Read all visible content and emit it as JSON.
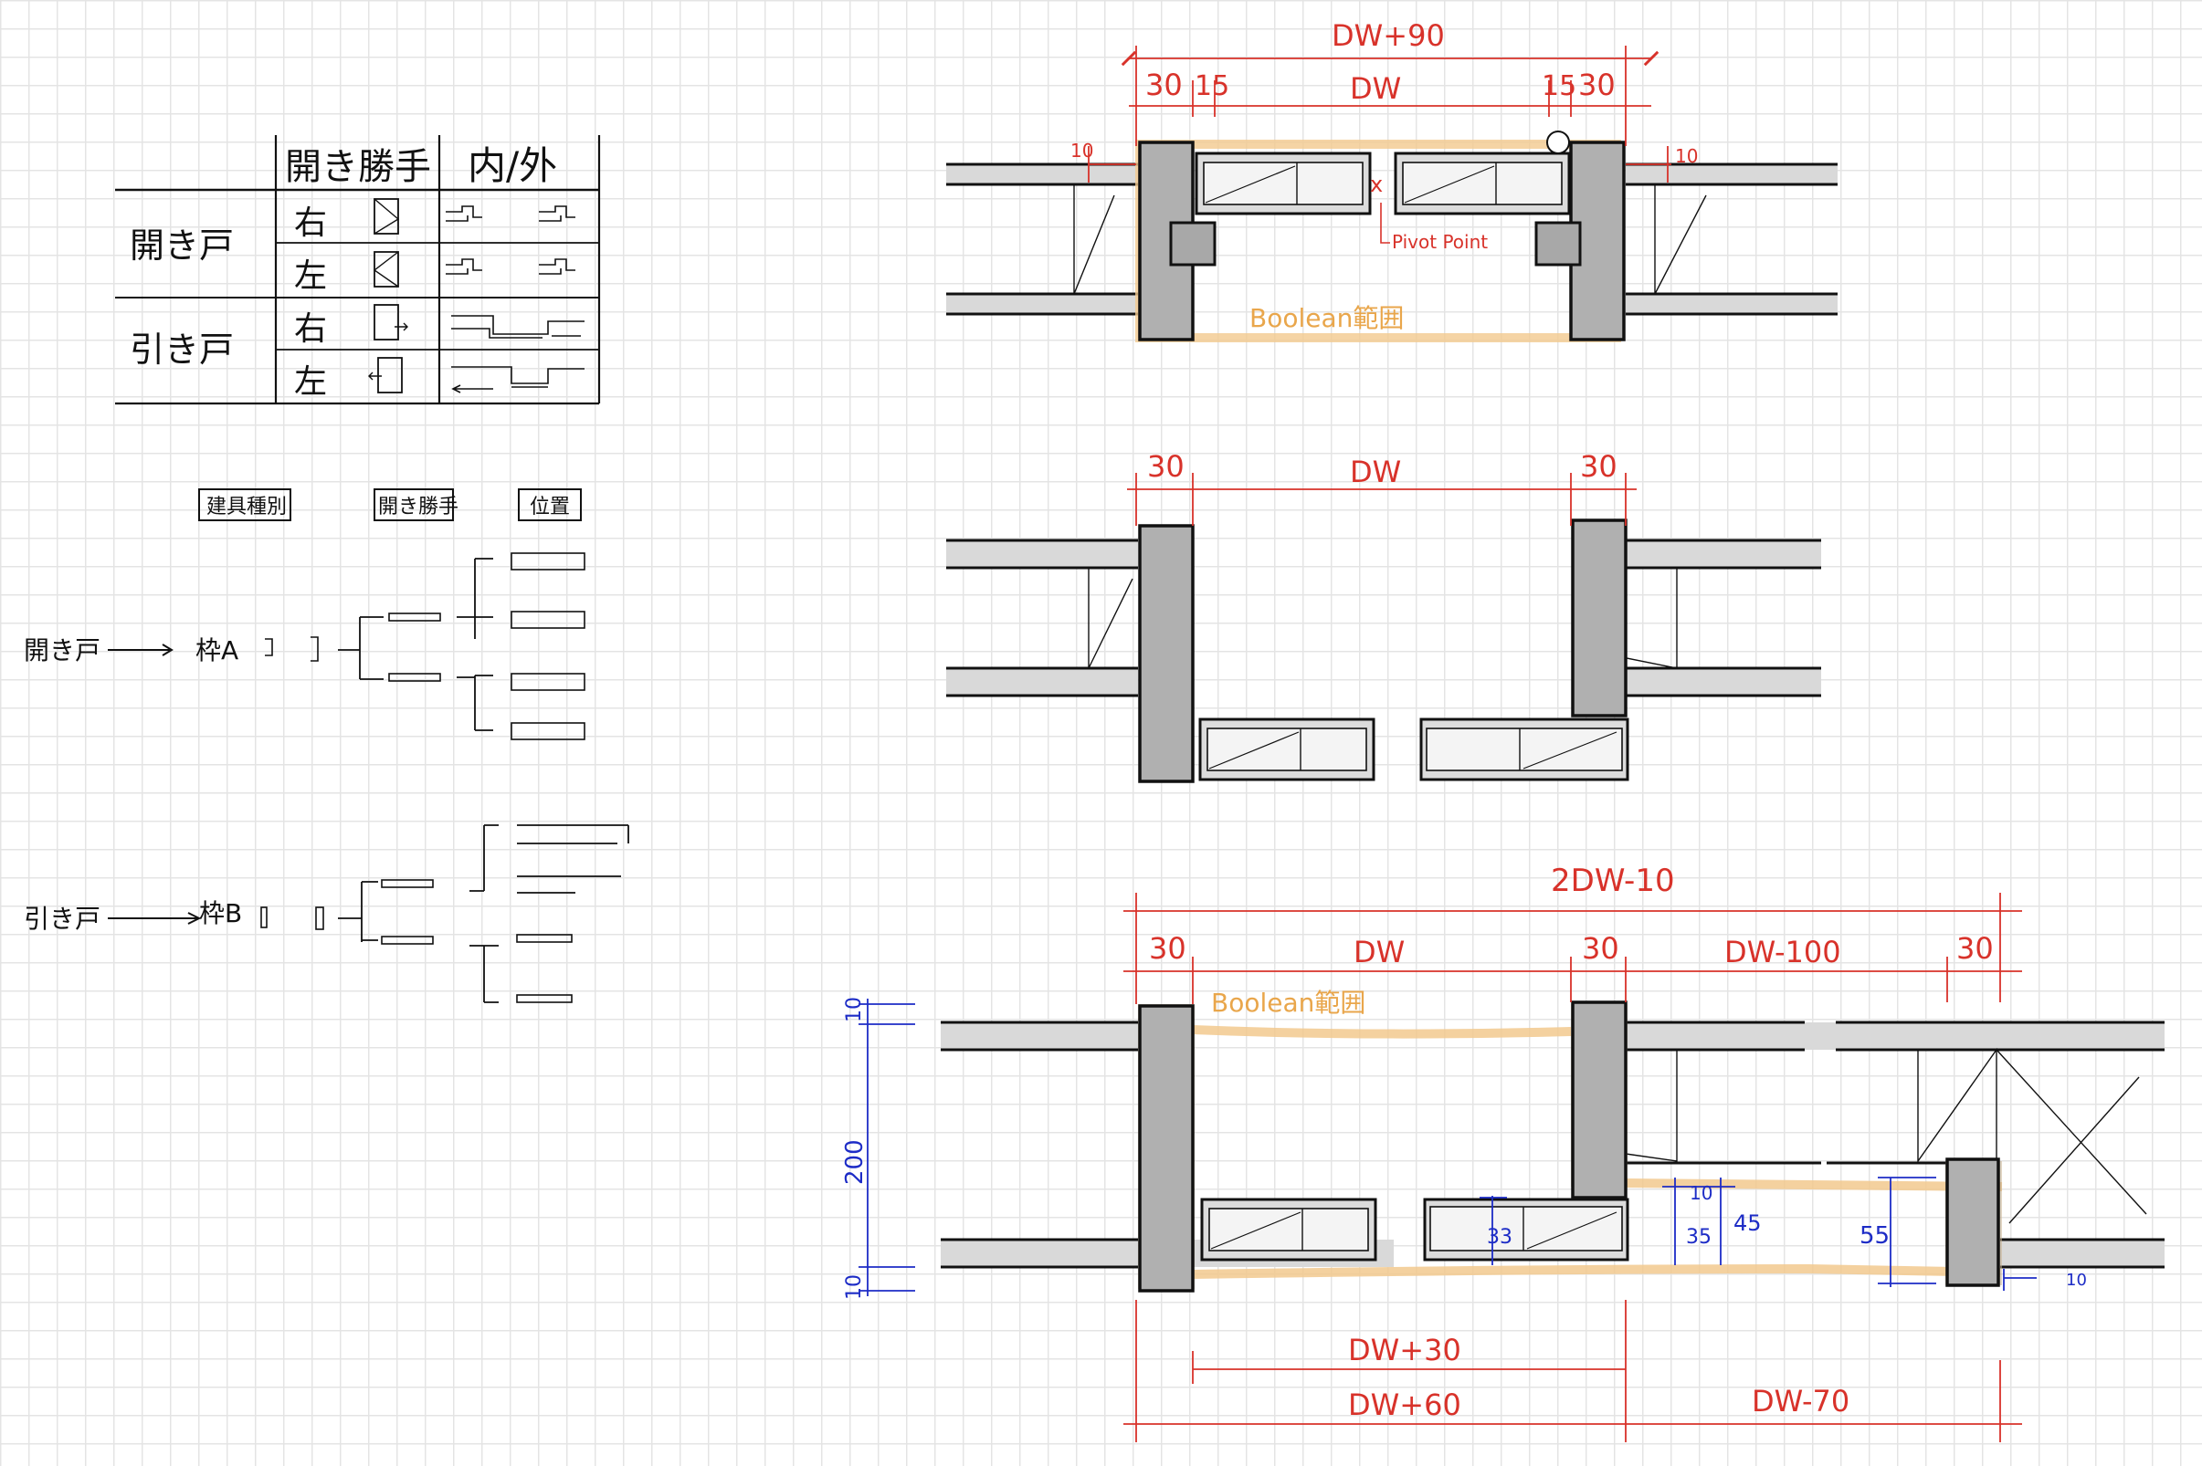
{
  "legend_table": {
    "header_opening": "開き勝手",
    "header_inout": "内/外",
    "row_group_swing": "開き戸",
    "row_group_sliding": "引き戸",
    "right": "右",
    "left": "左"
  },
  "tree": {
    "label_type": "建具種別",
    "label_opening": "開き勝手",
    "label_position": "位置",
    "swing_door": "開き戸",
    "swing_frame": "枠A",
    "sliding_door": "引き戸",
    "sliding_frame": "枠B"
  },
  "plan_top": {
    "total": "DW+90",
    "seg_30_left": "30",
    "seg_15_left": "15",
    "seg_dw": "DW",
    "seg_15_right": "15",
    "seg_30_right": "30",
    "offset_left": "10",
    "offset_right": "10",
    "pivot": "Pivot Point",
    "boolean": "Boolean範囲"
  },
  "plan_middle": {
    "seg_30_left": "30",
    "seg_dw": "DW",
    "seg_30_right": "30"
  },
  "plan_bottom": {
    "total": "2DW-10",
    "seg_30_a": "30",
    "seg_dw": "DW",
    "seg_30_b": "30",
    "seg_dw100": "DW-100",
    "seg_30_c": "30",
    "boolean": "Boolean範囲",
    "dim_10_top": "10",
    "dim_200": "200",
    "dim_10_bottom": "10",
    "dim_33": "33",
    "dim_10_mid": "10",
    "dim_35": "35",
    "dim_45": "45",
    "dim_55": "55",
    "dim_10_right": "10",
    "below_dw30": "DW+30",
    "below_dw60": "DW+60",
    "below_dw70": "DW-70"
  },
  "colors": {
    "ink": "#111111",
    "dimension_red": "#d8322a",
    "dimension_blue": "#1d2cc6",
    "boolean_orange": "#f2c98e",
    "wall_gray": "#d9d9d9",
    "frame_gray": "#b0b0b0"
  }
}
